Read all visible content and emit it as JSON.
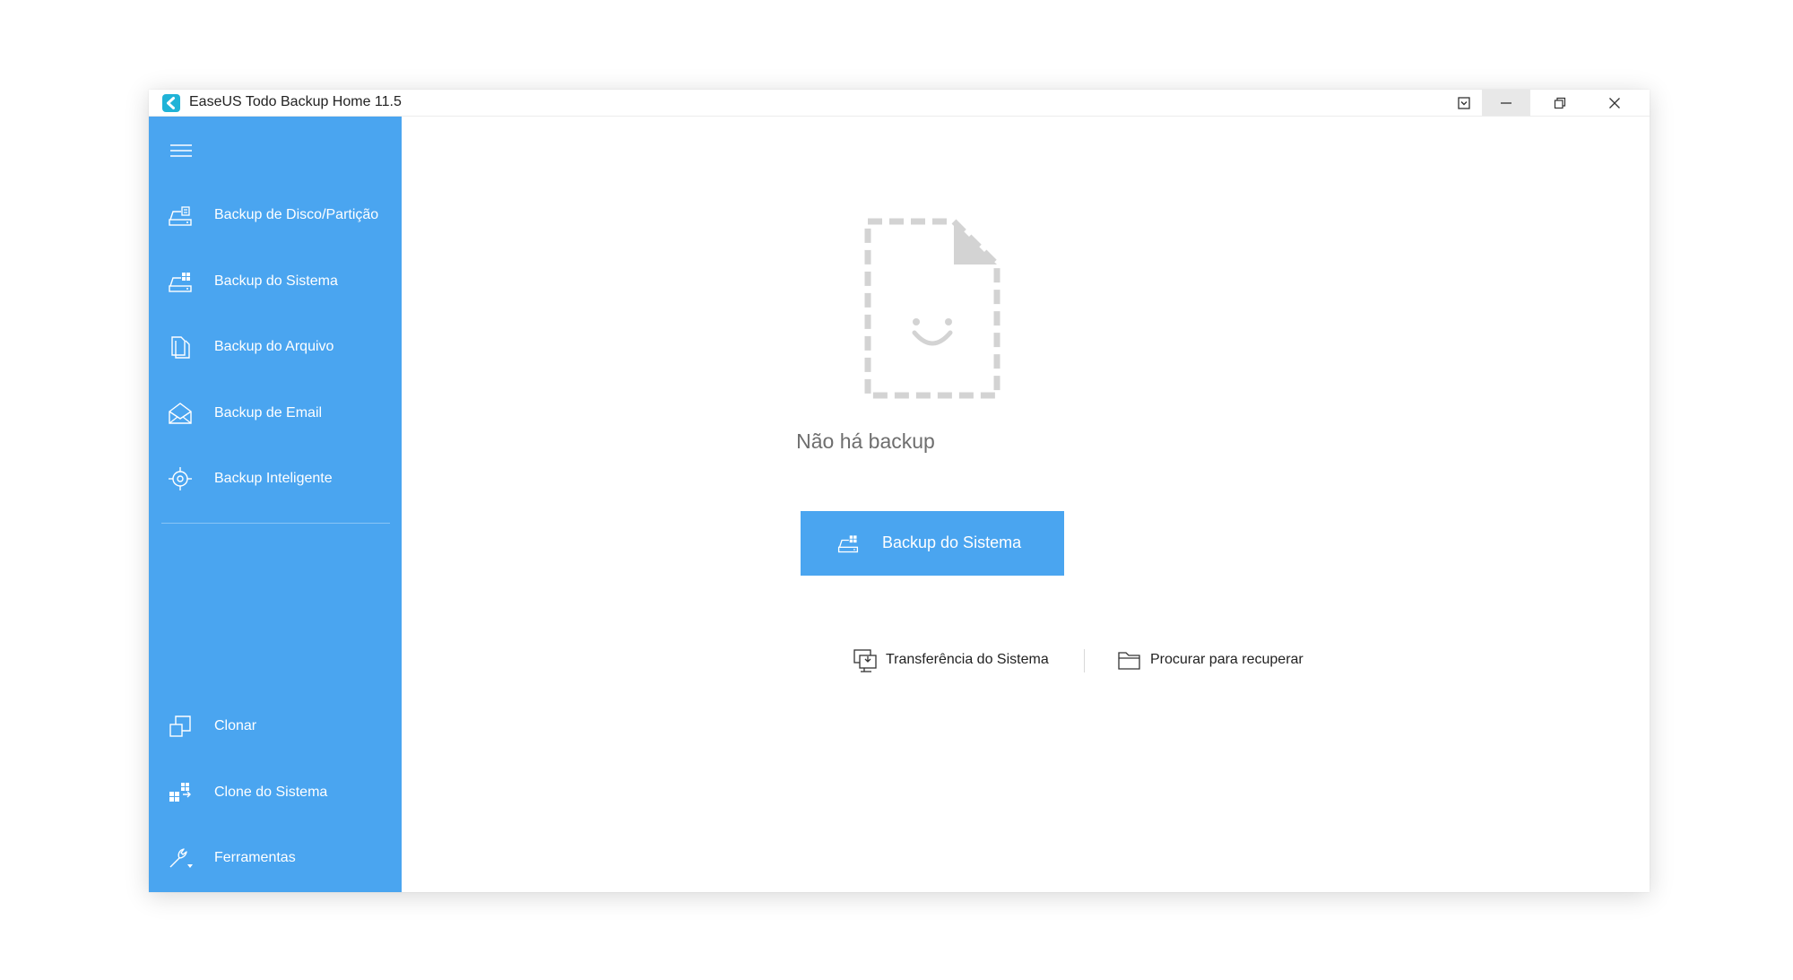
{
  "window": {
    "title": "EaseUS Todo Backup Home 11.5",
    "accent_color": "#4aa5f0",
    "controls": [
      "dropdown-icon",
      "minimize-icon",
      "restore-icon",
      "close-icon"
    ]
  },
  "sidebar": {
    "menu_icon": "hamburger-icon",
    "items": [
      {
        "label": "Backup de Disco/Partição",
        "icon": "disk-backup-icon"
      },
      {
        "label": "Backup do Sistema",
        "icon": "system-backup-icon"
      },
      {
        "label": "Backup do Arquivo",
        "icon": "file-backup-icon"
      },
      {
        "label": "Backup de Email",
        "icon": "email-backup-icon"
      },
      {
        "label": "Backup Inteligente",
        "icon": "smart-backup-icon"
      }
    ],
    "bottom_items": [
      {
        "label": "Clonar",
        "icon": "clone-icon"
      },
      {
        "label": "Clone do Sistema",
        "icon": "system-clone-icon"
      },
      {
        "label": "Ferramentas",
        "icon": "tools-icon"
      }
    ]
  },
  "main": {
    "empty_icon": "empty-document-smiley-icon",
    "empty_text": "Não há backup",
    "primary_button": "Backup do Sistema",
    "links": [
      {
        "label": "Transferência do Sistema",
        "icon": "system-transfer-icon"
      },
      {
        "label": "Procurar para recuperar",
        "icon": "folder-icon"
      }
    ]
  }
}
